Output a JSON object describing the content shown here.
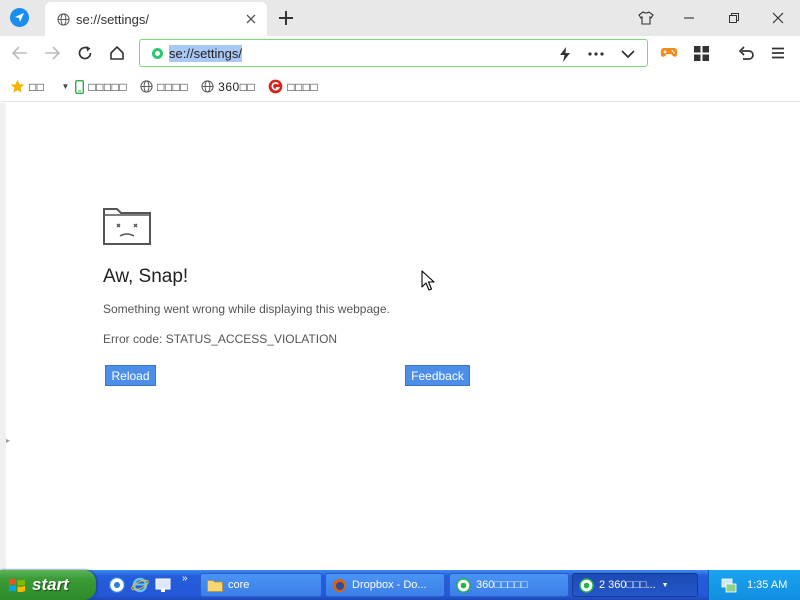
{
  "tab": {
    "title": "se://settings/"
  },
  "omnibox": {
    "url": "se://settings/"
  },
  "bookmarks": [
    {
      "label": "□□",
      "icon": "star-icon"
    },
    {
      "label": "□□□□□",
      "icon": "phone-icon"
    },
    {
      "label": "□□□□",
      "icon": "globe-icon"
    },
    {
      "label": "360□□",
      "icon": "globe-icon"
    },
    {
      "label": "□□□□",
      "icon": "game-center-icon"
    }
  ],
  "error": {
    "title": "Aw, Snap!",
    "message": "Something went wrong while displaying this webpage.",
    "code": "Error code: STATUS_ACCESS_VIOLATION",
    "reload_label": "Reload",
    "feedback_label": "Feedback"
  },
  "taskbar": {
    "start_label": "start",
    "tasks": [
      {
        "label": "core",
        "icon": "folder-icon"
      },
      {
        "label": "Dropbox - Do...",
        "icon": "firefox-icon"
      },
      {
        "label": "360□□□□□",
        "icon": "360-browser-icon"
      },
      {
        "label": "2 360□□□...",
        "icon": "360-browser-icon",
        "active": true
      }
    ],
    "clock": "1:35 AM"
  },
  "colors": {
    "accent": "#4d8fe8",
    "secure": "#2ec770",
    "taskbar": "#245edb",
    "start": "#3a9b36"
  }
}
